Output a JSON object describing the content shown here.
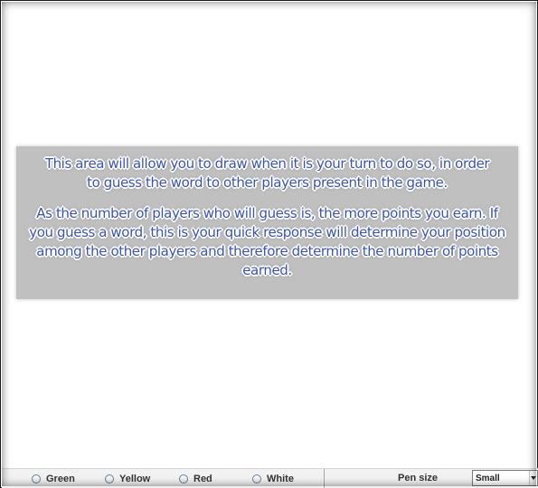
{
  "overlay": {
    "paragraph1": "This area will allow you to draw when it is your turn to do so, in order to guess the word to other players present in the game.",
    "paragraph2": "As the number of players who will guess is, the more points you earn. If you guess a word, this is your quick response will determine your position among the other players and therefore determine the number of points earned."
  },
  "toolbar": {
    "colors": [
      {
        "label": "Green"
      },
      {
        "label": "Yellow"
      },
      {
        "label": "Red"
      },
      {
        "label": "White"
      }
    ],
    "pen_size_label": "Pen size",
    "pen_size_value": "Small"
  },
  "colors": {
    "overlay_background": "#c0c0c0",
    "overlay_text": "#3a55a8",
    "toolbar_background": "#f2f2f2"
  }
}
